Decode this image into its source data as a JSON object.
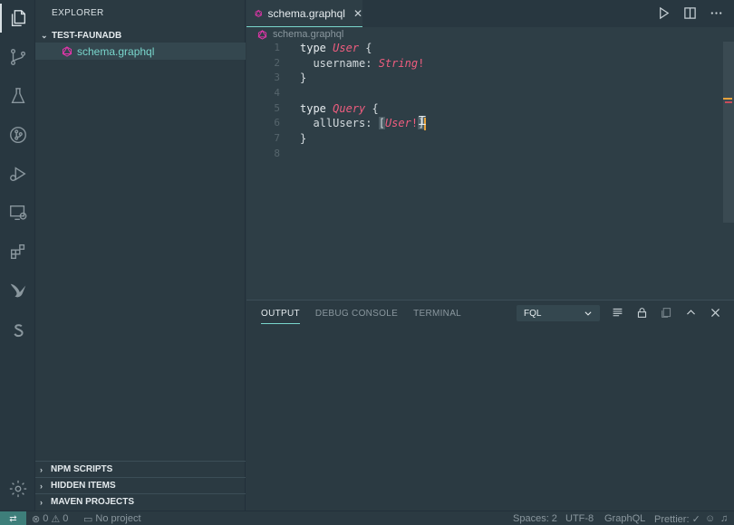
{
  "sidebar": {
    "title": "EXPLORER",
    "folder": "TEST-FAUNADB",
    "file": "schema.graphql",
    "sections": [
      "NPM SCRIPTS",
      "HIDDEN ITEMS",
      "MAVEN PROJECTS"
    ]
  },
  "editor": {
    "tab": {
      "label": "schema.graphql",
      "close": "✕"
    },
    "breadcrumb": "schema.graphql",
    "lines": [
      "1",
      "2",
      "3",
      "4",
      "5",
      "6",
      "7",
      "8"
    ],
    "code": {
      "kw_type": "type",
      "user": "User",
      "open": " {",
      "username_field": "  username: ",
      "string_type": "String",
      "bang": "!",
      "close": "}",
      "query": "Query",
      "allusers_field": "  allUsers: ",
      "lbracket": "[",
      "user2": "User",
      "rbracket": "]"
    }
  },
  "panel": {
    "tabs": [
      "OUTPUT",
      "DEBUG CONSOLE",
      "TERMINAL"
    ],
    "select_value": "FQL"
  },
  "status": {
    "errors": "0",
    "warnings": "0",
    "project": "No project",
    "spaces": "Spaces: 2",
    "encoding": "UTF-8",
    "language": "GraphQL",
    "prettier": "Prettier: ✓"
  },
  "colors": {
    "accent": "#79d6cc",
    "type_name": "#ef5d7f",
    "cursor": "#e6a23c",
    "background": "#2b3a42"
  }
}
